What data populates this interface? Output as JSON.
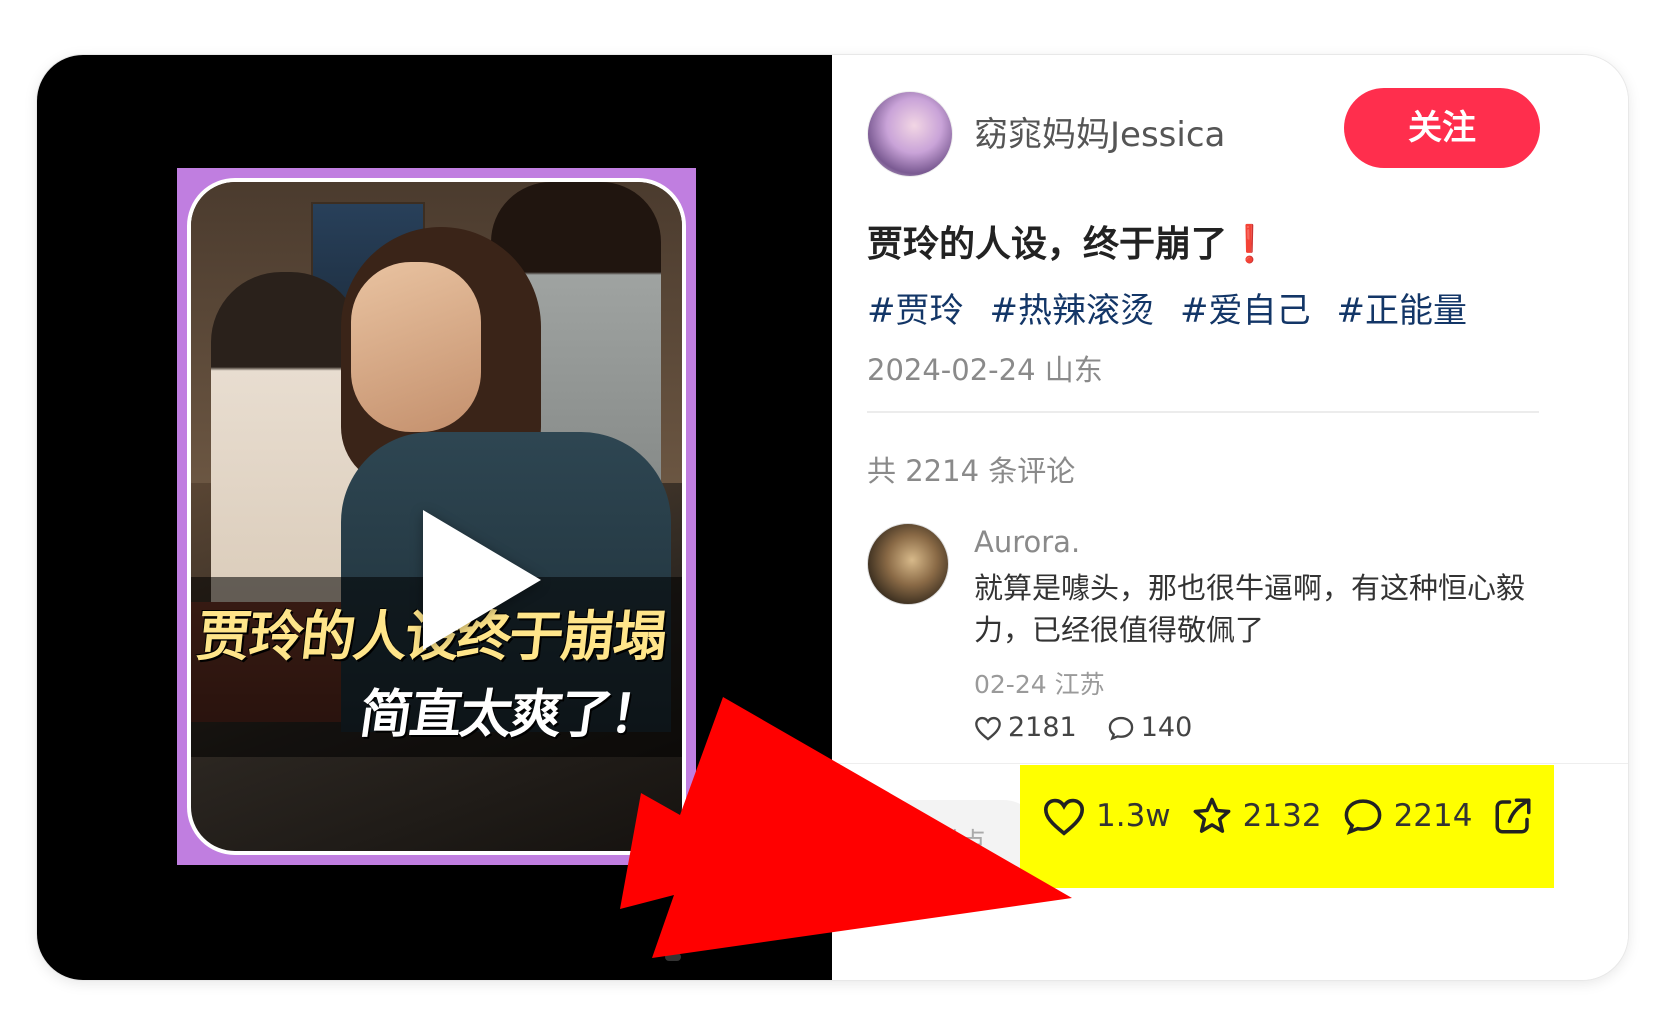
{
  "author": {
    "name": "窈窕妈妈Jessica",
    "follow_label": "关注"
  },
  "post": {
    "title": "贾玲的人设，终于崩了",
    "title_emoji": "❗",
    "tags": [
      "#贾玲",
      "#热辣滚烫",
      "#爱自己",
      "#正能量"
    ],
    "date_location": "2024-02-24 山东"
  },
  "video": {
    "caption_line1": "贾玲的人设终于崩塌",
    "caption_line2": "简直太爽了！"
  },
  "comments": {
    "count_text": "共 2214 条评论",
    "items": [
      {
        "user": "Aurora.",
        "text": "就算是噱头，那也很牛逼啊，有这种恒心毅力，已经很值得敬佩了",
        "meta": "02-24 江苏",
        "likes": "2181",
        "replies": "140"
      }
    ]
  },
  "action_bar": {
    "input_placeholder": "说点",
    "likes": "1.3w",
    "collects": "2132",
    "comments": "2214"
  },
  "colors": {
    "accent": "#ff2e4d",
    "tag": "#133667",
    "highlight": "#ffff00",
    "arrow": "#ff0000"
  }
}
